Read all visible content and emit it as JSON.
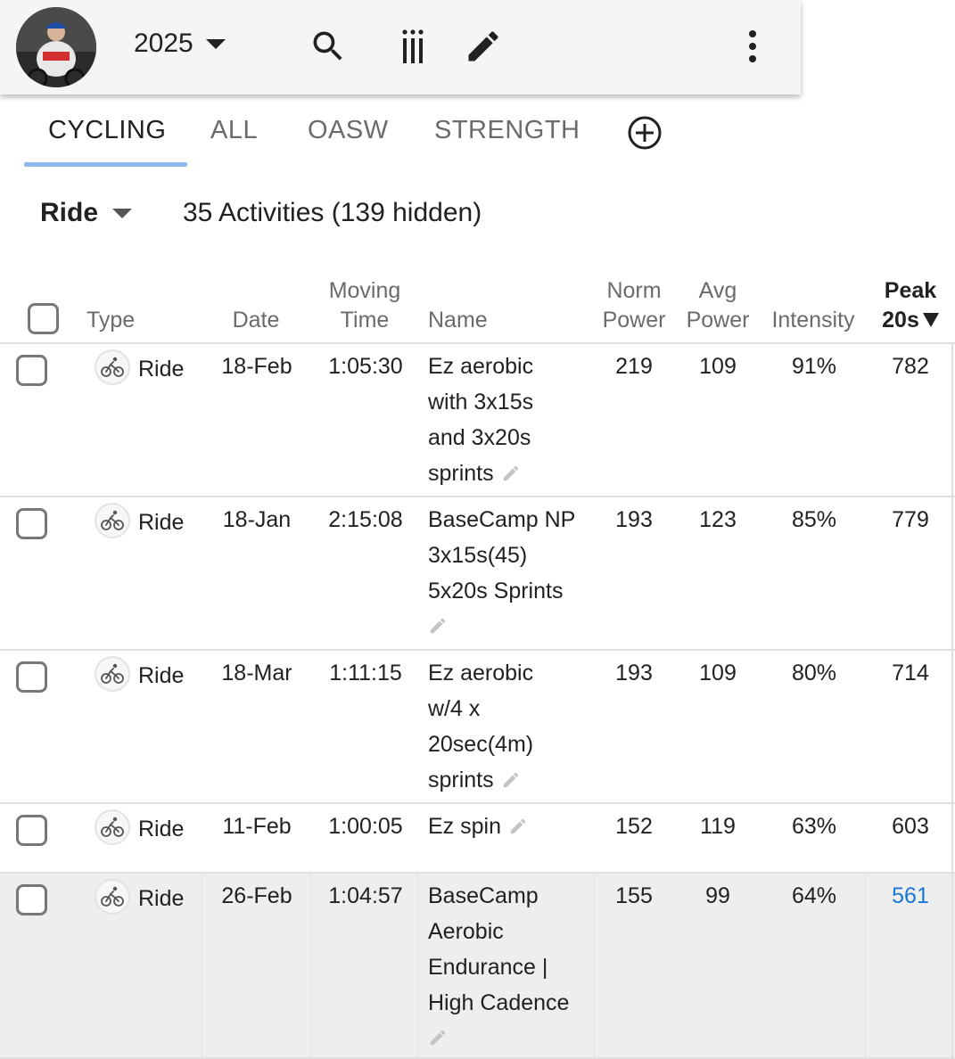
{
  "toolbar": {
    "year": "2025",
    "icons": [
      "avatar",
      "search-icon",
      "columns-icon",
      "edit-icon",
      "more-vert-icon"
    ]
  },
  "tabs": [
    {
      "label": "CYCLING",
      "active": true
    },
    {
      "label": "ALL",
      "active": false
    },
    {
      "label": "OASW",
      "active": false
    },
    {
      "label": "STRENGTH",
      "active": false
    }
  ],
  "filter": {
    "type": "Ride",
    "count_text": "35 Activities (139 hidden)"
  },
  "table": {
    "headers": {
      "type": "Type",
      "date": "Date",
      "moving_time_1": "Moving",
      "moving_time_2": "Time",
      "name": "Name",
      "norm_power_1": "Norm",
      "norm_power_2": "Power",
      "avg_power_1": "Avg",
      "avg_power_2": "Power",
      "intensity": "Intensity",
      "peak_1": "Peak",
      "peak_2": "20s"
    },
    "sort_column": "Peak 20s",
    "sort_direction": "descending",
    "rows": [
      {
        "type": "Ride",
        "date": "18-Feb",
        "moving_time": "1:05:30",
        "name": [
          "Ez aerobic",
          "with 3x15s",
          "and 3x20s",
          "sprints"
        ],
        "norm_power": "219",
        "avg_power": "109",
        "intensity": "91%",
        "peak_20s": "782"
      },
      {
        "type": "Ride",
        "date": "18-Jan",
        "moving_time": "2:15:08",
        "name": [
          "BaseCamp NP",
          "3x15s(45)",
          "5x20s Sprints"
        ],
        "norm_power": "193",
        "avg_power": "123",
        "intensity": "85%",
        "peak_20s": "779"
      },
      {
        "type": "Ride",
        "date": "18-Mar",
        "moving_time": "1:11:15",
        "name": [
          "Ez aerobic",
          "w/4 x",
          "20sec(4m)",
          "sprints"
        ],
        "norm_power": "193",
        "avg_power": "109",
        "intensity": "80%",
        "peak_20s": "714"
      },
      {
        "type": "Ride",
        "date": "11-Feb",
        "moving_time": "1:00:05",
        "name": [
          "Ez spin"
        ],
        "norm_power": "152",
        "avg_power": "119",
        "intensity": "63%",
        "peak_20s": "603"
      },
      {
        "type": "Ride",
        "date": "26-Feb",
        "moving_time": "1:04:57",
        "name": [
          "BaseCamp",
          "Aerobic",
          "Endurance |",
          "High Cadence"
        ],
        "norm_power": "155",
        "avg_power": "99",
        "intensity": "64%",
        "peak_20s": "561"
      }
    ]
  },
  "colors": {
    "tab_indicator": "#90b8f0",
    "link": "#1976d2",
    "toolbar_bg": "#f5f5f5",
    "highlight_row": "#eeeeee"
  }
}
